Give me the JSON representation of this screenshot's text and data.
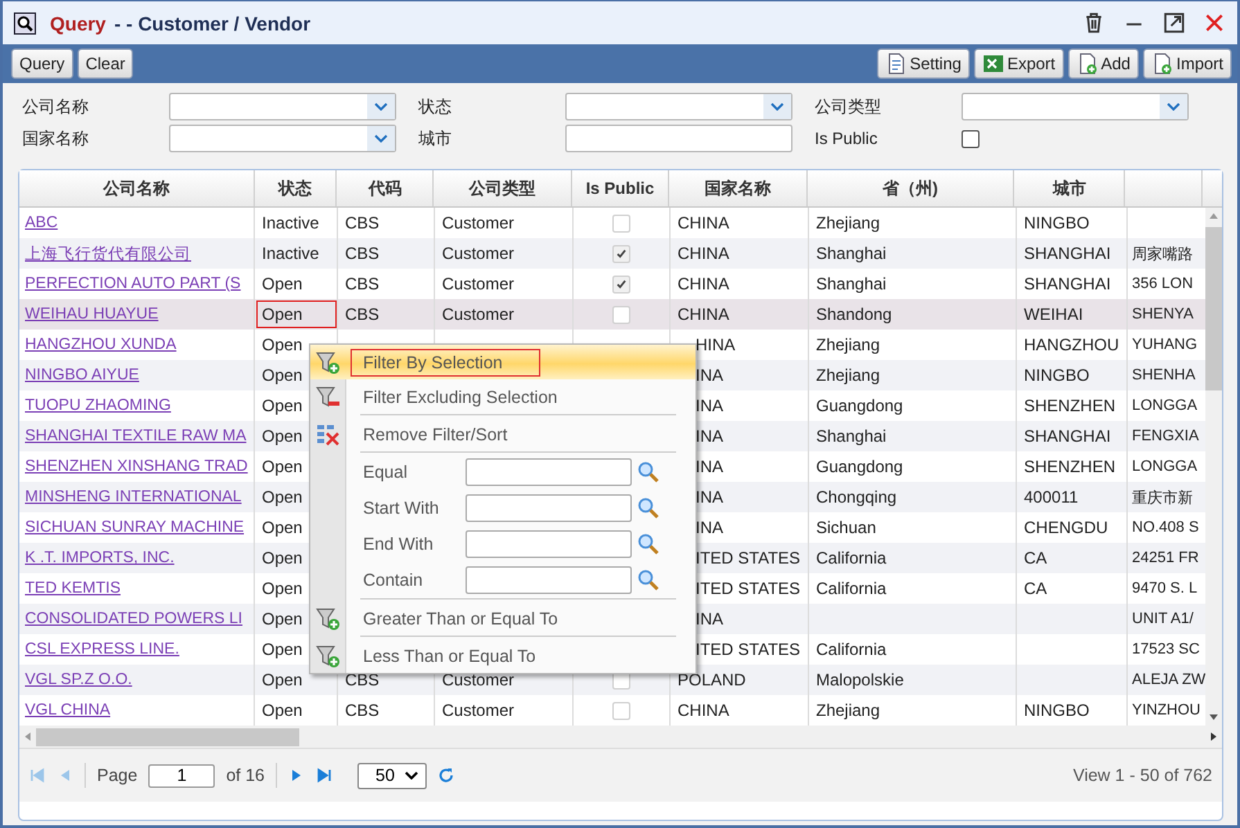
{
  "window": {
    "title_prefix": "Query",
    "title": "- - Customer / Vendor"
  },
  "toolbar": {
    "left": [
      "Query",
      "Clear"
    ],
    "right": [
      "Setting",
      "Export",
      "Add",
      "Import"
    ]
  },
  "filters": [
    {
      "label": "公司名称",
      "kind": "select"
    },
    {
      "label": "状态",
      "kind": "select"
    },
    {
      "label": "公司类型",
      "kind": "select"
    },
    {
      "label": "国家名称",
      "kind": "select"
    },
    {
      "label": "城市",
      "kind": "text"
    },
    {
      "label": "Is Public",
      "kind": "checkbox",
      "checked": false
    }
  ],
  "grid": {
    "columns": [
      "公司名称",
      "状态",
      "代码",
      "公司类型",
      "Is Public",
      "国家名称",
      "省（州)",
      "城市"
    ],
    "rows": [
      {
        "name": "ABC",
        "status": "Inactive",
        "code": "CBS",
        "type": "Customer",
        "public": false,
        "country": "CHINA",
        "province": "Zhejiang",
        "city": "NINGBO",
        "column_9": "",
        "selected": false,
        "status_focused": false
      },
      {
        "name": "上海飞行货代有限公司",
        "status": "Inactive",
        "code": "CBS",
        "type": "Customer",
        "public": true,
        "country": "CHINA",
        "province": "Shanghai",
        "city": "SHANGHAI",
        "column_9": "周家嘴路",
        "selected": false,
        "status_focused": false
      },
      {
        "name": "PERFECTION AUTO PART (S",
        "status": "Open",
        "code": "CBS",
        "type": "Customer",
        "public": true,
        "country": "CHINA",
        "province": "Shanghai",
        "city": "SHANGHAI",
        "column_9": "356 LON",
        "selected": false,
        "status_focused": false
      },
      {
        "name": "WEIHAU HUAYUE",
        "status": "Open",
        "code": "CBS",
        "type": "Customer",
        "public": false,
        "country": "CHINA",
        "province": "Shandong",
        "city": "WEIHAI",
        "column_9": "SHENYA",
        "selected": true,
        "status_focused": true
      },
      {
        "name": "HANGZHOU XUNDA",
        "status": "Open",
        "country": "HINA",
        "province": "Zhejiang",
        "city": "HANGZHOU",
        "column_9": "YUHANG",
        "selected": false,
        "status_focused": false
      },
      {
        "name": "NINGBO AIYUE",
        "status": "Open",
        "country": "INA",
        "province": "Zhejiang",
        "city": "NINGBO",
        "column_9": "SHENHA",
        "selected": false,
        "status_focused": false
      },
      {
        "name": "TUOPU ZHAOMING",
        "status": "Open",
        "country": "INA",
        "province": "Guangdong",
        "city": "SHENZHEN",
        "column_9": "LONGGA",
        "selected": false,
        "status_focused": false
      },
      {
        "name": "SHANGHAI TEXTILE RAW MA",
        "status": "Open",
        "country": "INA",
        "province": "Shanghai",
        "city": "SHANGHAI",
        "column_9": "FENGXIA",
        "selected": false,
        "status_focused": false
      },
      {
        "name": "SHENZHEN XINSHANG TRAD",
        "status": "Open",
        "country": "INA",
        "province": "Guangdong",
        "city": "SHENZHEN",
        "column_9": "LONGGA",
        "selected": false,
        "status_focused": false
      },
      {
        "name": "MINSHENG INTERNATIONAL",
        "status": "Open",
        "country": "INA",
        "province": "Chongqing",
        "city": "400011",
        "column_9": "重庆市新",
        "selected": false,
        "status_focused": false
      },
      {
        "name": "SICHUAN SUNRAY MACHINE",
        "status": "Open",
        "country": "INA",
        "province": "Sichuan",
        "city": "CHENGDU",
        "column_9": "NO.408 S",
        "selected": false,
        "status_focused": false
      },
      {
        "name": "K .T. IMPORTS, INC.",
        "status": "Open",
        "country": "ITED STATES",
        "province": "California",
        "city": "CA",
        "column_9": "24251 FR",
        "selected": false,
        "status_focused": false
      },
      {
        "name": "TED KEMTIS",
        "status": "Open",
        "country": "ITED STATES",
        "province": "California",
        "city": "CA",
        "column_9": "9470 S. L",
        "selected": false,
        "status_focused": false
      },
      {
        "name": "CONSOLIDATED POWERS LI",
        "status": "Open",
        "country": "INA",
        "province": "",
        "city": "",
        "column_9": "UNIT A1/",
        "selected": false,
        "status_focused": false
      },
      {
        "name": "CSL EXPRESS LINE.",
        "status": "Open",
        "country": "ITED STATES",
        "province": "California",
        "city": "",
        "column_9": "17523 SC",
        "selected": false,
        "status_focused": false
      },
      {
        "name": "VGL SP.Z O.O.",
        "status": "Open",
        "code": "CBS",
        "type": "Customer",
        "public": false,
        "country": "POLAND",
        "province": "Malopolskie",
        "city": "",
        "column_9": "ALEJA ZW",
        "selected": false,
        "status_focused": false
      },
      {
        "name": "VGL CHINA",
        "status": "Open",
        "code": "CBS",
        "type": "Customer",
        "public": false,
        "country": "CHINA",
        "province": "Zhejiang",
        "city": "NINGBO",
        "column_9": "YINZHOU",
        "selected": false,
        "status_focused": false
      }
    ]
  },
  "context_menu": [
    {
      "kind": "include",
      "label": "Filter By Selection",
      "selected": true
    },
    {
      "kind": "exclude",
      "label": "Filter Excluding Selection",
      "selected": false
    },
    {
      "kind": "clear",
      "label": "Remove Filter/Sort",
      "selected": false
    },
    {
      "kind": "input",
      "label": "Equal"
    },
    {
      "kind": "input",
      "label": "Start With"
    },
    {
      "kind": "input",
      "label": "End With"
    },
    {
      "kind": "input",
      "label": "Contain"
    },
    {
      "kind": "include",
      "label": "Greater Than or Equal To",
      "selected": false
    },
    {
      "kind": "include",
      "label": "Less Than or Equal To",
      "selected": false
    }
  ],
  "pager": {
    "page_label": "Page",
    "page": "1",
    "of": "of 16",
    "page_size": "50",
    "view": "View 1 - 50 of 762"
  }
}
